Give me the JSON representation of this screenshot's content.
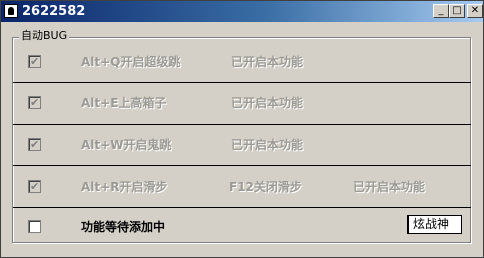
{
  "window": {
    "title": "2622582",
    "min_symbol": "_",
    "max_symbol": "□",
    "close_symbol": "✕"
  },
  "group": {
    "label": "自动BUG"
  },
  "rows": [
    {
      "checked": true,
      "enabled": false,
      "hotkey": "Alt+Q开启超级跳",
      "status": "已开启本功能",
      "extra": ""
    },
    {
      "checked": true,
      "enabled": false,
      "hotkey": "Alt+E上高箱子",
      "status": "已开启本功能",
      "extra": ""
    },
    {
      "checked": true,
      "enabled": false,
      "hotkey": "Alt+W开启鬼跳",
      "status": "已开启本功能",
      "extra": ""
    },
    {
      "checked": true,
      "enabled": false,
      "hotkey": "Alt+R开启滑步",
      "status": "已开启本功能",
      "extra": "F12关闭滑步"
    },
    {
      "checked": false,
      "enabled": true,
      "hotkey": "功能等待添加中",
      "status": "",
      "extra": "",
      "input_value": "炫战神"
    }
  ],
  "check_mark": "✔"
}
